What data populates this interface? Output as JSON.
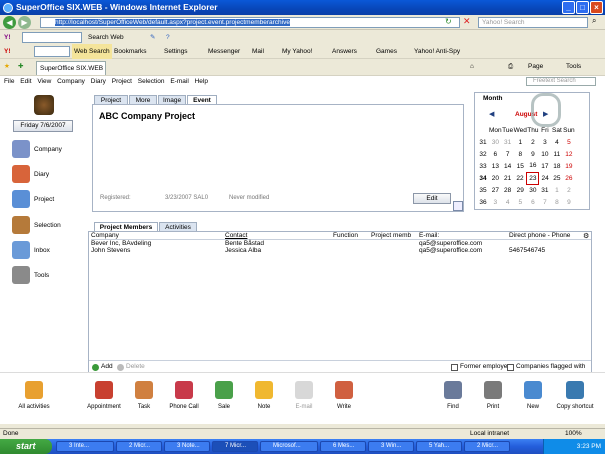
{
  "window": {
    "title": "SuperOffice SIX.WEB - Windows Internet Explorer"
  },
  "ie": {
    "address": "http://localhost/SuperOfficeWeb/default.aspx?project.event.projectmemberarchive",
    "search_placeholder": "Yahoo! Search",
    "search_web": "Search Web",
    "web_search": "Web Search",
    "bookmarks": "Bookmarks",
    "settings": "Settings",
    "messenger": "Messenger",
    "mail": "Mail",
    "my_yahoo": "My Yahoo!",
    "answers": "Answers",
    "games": "Games",
    "antispy": "Yahoo! Anti-Spy",
    "tab_title": "SuperOffice SIX.WEB",
    "page": "Page",
    "tools": "Tools"
  },
  "app_menu": {
    "items": [
      "File",
      "Edit",
      "View",
      "Company",
      "Diary",
      "Project",
      "Selection",
      "E-mail",
      "Help"
    ],
    "search_placeholder": "Freetext Search"
  },
  "left_nav": {
    "date": "Friday 7/6/2007",
    "items": [
      "Company",
      "Diary",
      "Project",
      "Selection",
      "Inbox",
      "Tools"
    ]
  },
  "project_card": {
    "tabs": [
      "Project",
      "More",
      "Image",
      "Event"
    ],
    "name": "ABC Company Project",
    "registered_label": "Registered:",
    "registered_value": "3/23/2007 SAL0",
    "modified": "Never modified",
    "edit": "Edit"
  },
  "calendar": {
    "tab": "Month",
    "month": "August",
    "days": [
      "Mon",
      "Tue",
      "Wed",
      "Thu",
      "Fri",
      "Sat",
      "Sun"
    ],
    "weeks": [
      {
        "no": "31",
        "days": [
          "30",
          "31",
          "1",
          "2",
          "3",
          "4",
          "5"
        ]
      },
      {
        "no": "32",
        "days": [
          "6",
          "7",
          "8",
          "9",
          "10",
          "11",
          "12"
        ]
      },
      {
        "no": "33",
        "days": [
          "13",
          "14",
          "15",
          "16",
          "17",
          "18",
          "19"
        ]
      },
      {
        "no": "34",
        "days": [
          "20",
          "21",
          "22",
          "23",
          "24",
          "25",
          "26"
        ]
      },
      {
        "no": "35",
        "days": [
          "27",
          "28",
          "29",
          "30",
          "31",
          "1",
          "2"
        ]
      },
      {
        "no": "36",
        "days": [
          "3",
          "4",
          "5",
          "6",
          "7",
          "8",
          "9"
        ]
      }
    ]
  },
  "members": {
    "tabs": [
      "Project Members",
      "Activities"
    ],
    "columns": [
      "Company",
      "Contact",
      "Function",
      "Project memb",
      "E-mail:",
      "Direct phone - Phone"
    ],
    "rows": [
      [
        "Bever Inc, BAvdeling",
        "Bente Båstad",
        "",
        "",
        "qa5@superoffice.com",
        ""
      ],
      [
        "John Stevens",
        "Jessica Alba",
        "",
        "",
        "qa5@superoffice.com",
        "5467546745"
      ]
    ],
    "add": "Add",
    "delete": "Delete",
    "former": "Former employees",
    "flagged": "Companies flagged with Stop"
  },
  "bottom_actions": [
    "All activities",
    "Appointment",
    "Task",
    "Phone Call",
    "Sale",
    "Note",
    "E-mail",
    "Write",
    "Find",
    "Print",
    "New",
    "Copy shortcut"
  ],
  "status": {
    "left": "Done",
    "zone": "Local intranet",
    "zoom": "100%"
  },
  "taskbar": {
    "start": "start",
    "tasks": [
      "3 Inte...",
      "2 Micr...",
      "3 Note...",
      "7 Micr...",
      "Microsof...",
      "6 Mes...",
      "3 Win...",
      "5 Yah...",
      "2 Micr..."
    ],
    "time": "3:23 PM"
  }
}
